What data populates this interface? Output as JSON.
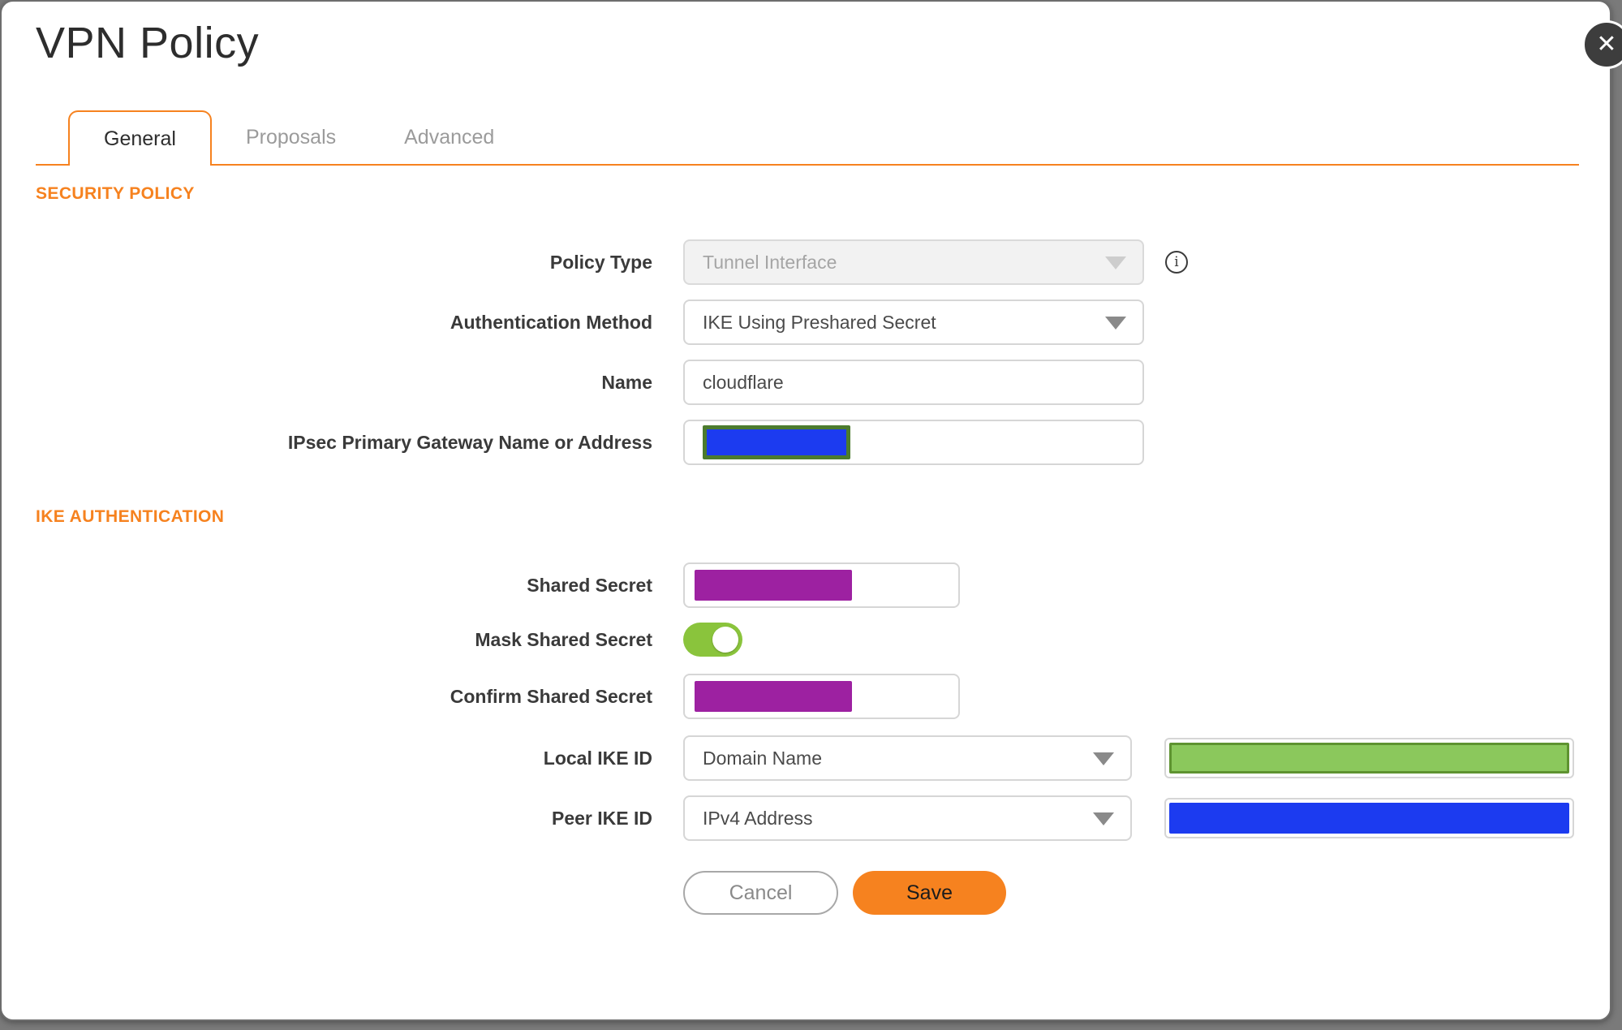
{
  "dialog": {
    "title": "VPN Policy",
    "close_icon": "✕",
    "info_icon": "i"
  },
  "tabs": [
    {
      "label": "General",
      "active": true
    },
    {
      "label": "Proposals",
      "active": false
    },
    {
      "label": "Advanced",
      "active": false
    }
  ],
  "security_policy": {
    "heading": "SECURITY POLICY",
    "policy_type": {
      "label": "Policy Type",
      "value": "Tunnel Interface",
      "disabled": true
    },
    "auth_method": {
      "label": "Authentication Method",
      "value": "IKE Using Preshared Secret"
    },
    "name": {
      "label": "Name",
      "value": "cloudflare"
    },
    "gateway": {
      "label": "IPsec Primary Gateway Name or Address",
      "value": "",
      "redaction": "blue block with green border"
    }
  },
  "ike_authentication": {
    "heading": "IKE AUTHENTICATION",
    "shared_secret": {
      "label": "Shared Secret",
      "value": "",
      "redaction": "purple block"
    },
    "mask_shared_secret": {
      "label": "Mask Shared Secret",
      "toggle_on": true
    },
    "confirm_shared_secret": {
      "label": "Confirm Shared Secret",
      "value": "",
      "redaction": "purple block"
    },
    "local_ike_id": {
      "label": "Local IKE ID",
      "value": "Domain Name",
      "redaction": "green block"
    },
    "peer_ike_id": {
      "label": "Peer IKE ID",
      "value": "IPv4 Address",
      "redaction": "blue block"
    }
  },
  "buttons": {
    "cancel": "Cancel",
    "save": "Save"
  },
  "colors": {
    "accent_orange": "#f6821f",
    "redact_purple": "#9d21a1",
    "redact_blue": "#1c3bf0",
    "redact_green_fill": "#8bc85c",
    "toggle_green": "#8ac43c"
  }
}
